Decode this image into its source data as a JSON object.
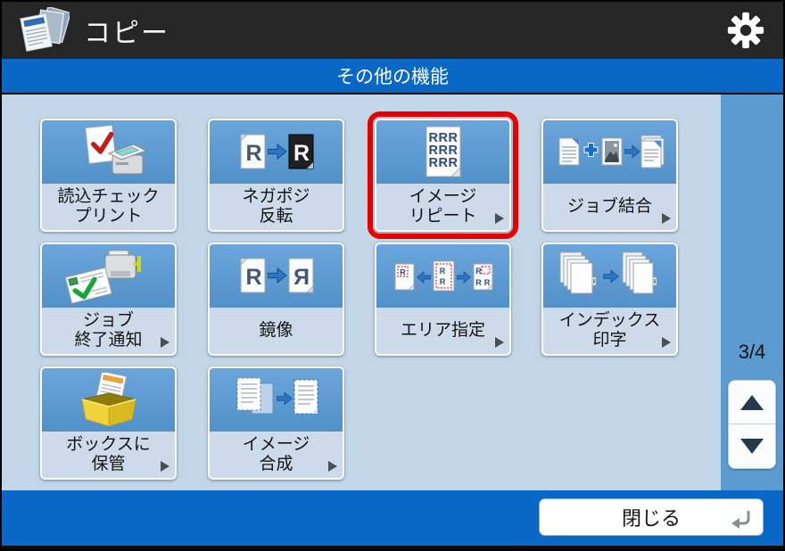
{
  "header": {
    "title": "コピー"
  },
  "subheader": {
    "title": "その他の機能"
  },
  "tiles": [
    {
      "label_line1": "読込チェック",
      "label_line2": "プリント",
      "icon": "scan-check-print-icon",
      "has_arrow": false,
      "highlighted": false
    },
    {
      "label_line1": "ネガポジ",
      "label_line2": "反転",
      "icon": "negative-positive-invert-icon",
      "has_arrow": false,
      "highlighted": false
    },
    {
      "label_line1": "イメージ",
      "label_line2": "リピート",
      "icon": "image-repeat-icon",
      "has_arrow": true,
      "highlighted": true
    },
    {
      "label_line1": "ジョブ結合",
      "label_line2": "",
      "icon": "job-combine-icon",
      "has_arrow": true,
      "highlighted": false
    },
    {
      "label_line1": "ジョブ",
      "label_line2": "終了通知",
      "icon": "job-end-notification-icon",
      "has_arrow": true,
      "highlighted": false
    },
    {
      "label_line1": "鏡像",
      "label_line2": "",
      "icon": "mirror-image-icon",
      "has_arrow": false,
      "highlighted": false
    },
    {
      "label_line1": "エリア指定",
      "label_line2": "",
      "icon": "area-designation-icon",
      "has_arrow": true,
      "highlighted": false
    },
    {
      "label_line1": "インデックス",
      "label_line2": "印字",
      "icon": "index-print-icon",
      "has_arrow": true,
      "highlighted": false
    },
    {
      "label_line1": "ボックスに",
      "label_line2": "保管",
      "icon": "store-in-box-icon",
      "has_arrow": true,
      "highlighted": false
    },
    {
      "label_line1": "イメージ",
      "label_line2": "合成",
      "icon": "image-composition-icon",
      "has_arrow": true,
      "highlighted": false
    }
  ],
  "icon_text": {
    "r": "R",
    "rrr": "RRR"
  },
  "pagination": {
    "page_indicator": "3/4"
  },
  "footer": {
    "close_label": "閉じる"
  },
  "colors": {
    "header_bg": "#262626",
    "accent_blue": "#0968c6",
    "main_bg": "#c3d6e8",
    "panel_blue": "#5c9bd2",
    "tile_label_bg": "#ccdae9",
    "highlight_red": "#e80000"
  }
}
